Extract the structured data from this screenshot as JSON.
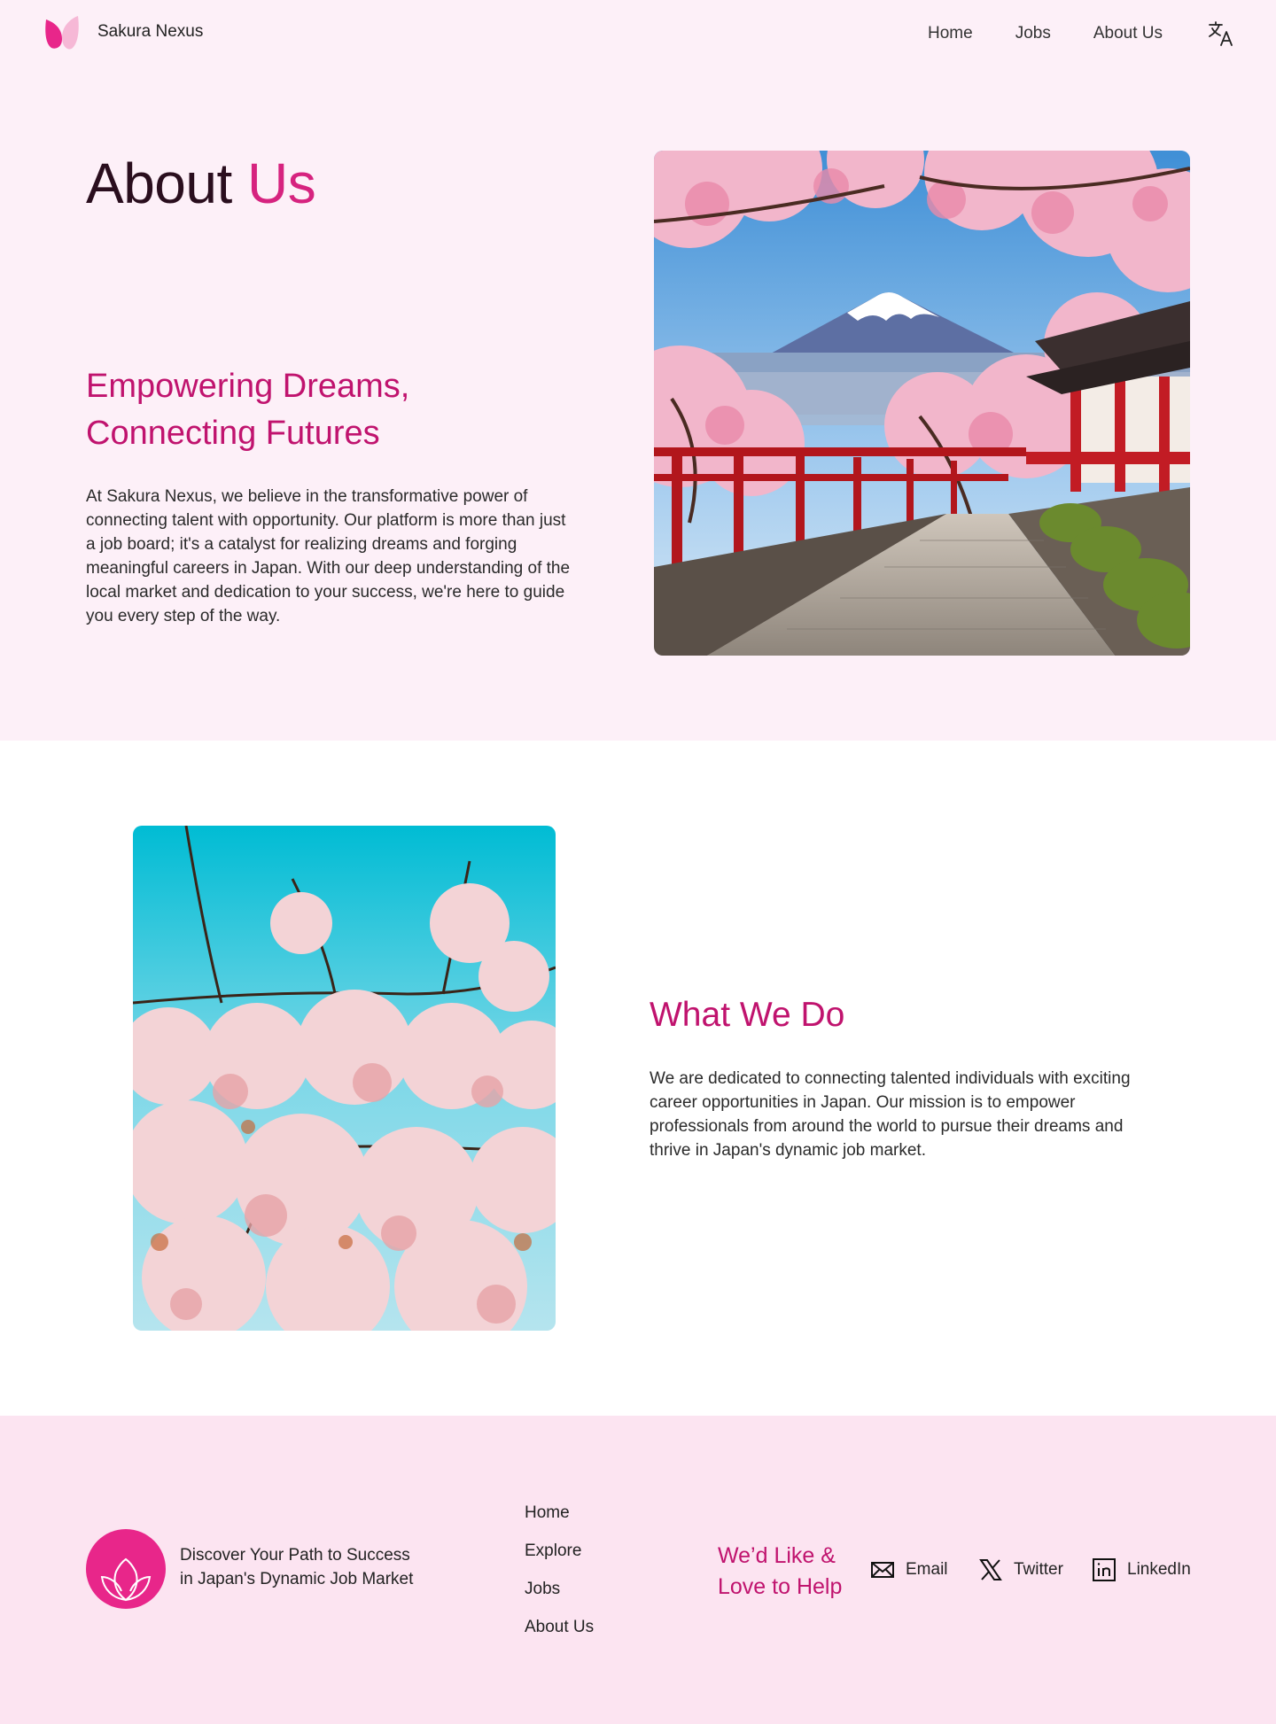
{
  "brand": {
    "name": "Sakura Nexus",
    "logo_icon": "sakura-petal-logo"
  },
  "nav": {
    "links": [
      {
        "label": "Home"
      },
      {
        "label": "Jobs"
      },
      {
        "label": "About Us"
      }
    ],
    "translate_icon": "translate-icon"
  },
  "hero": {
    "title_main": "About",
    "title_accent": "Us",
    "subtitle": "Empowering Dreams, Connecting Futures",
    "body": "At Sakura Nexus, we believe in the transformative power of connecting talent with opportunity. Our platform is more than just a job board; it's a catalyst for realizing dreams and forging meaningful careers in Japan. With our deep understanding of the local market and dedication to your success, we're here to guide you every step of the way."
  },
  "what_we_do": {
    "title": "What We Do",
    "body": "We are dedicated to connecting talented individuals with exciting career opportunities in Japan. Our mission is to empower professionals from around the world to pursue their dreams and thrive in Japan's dynamic job market."
  },
  "footer": {
    "tagline": "Discover Your Path to Success in Japan's Dynamic Job Market",
    "links": [
      {
        "label": "Home"
      },
      {
        "label": "Explore"
      },
      {
        "label": "Jobs"
      },
      {
        "label": "About Us"
      }
    ],
    "help_text": "We’d Like & Love to Help",
    "social": [
      {
        "label": "Email",
        "icon": "email-icon"
      },
      {
        "label": "Twitter",
        "icon": "x-twitter-icon"
      },
      {
        "label": "LinkedIn",
        "icon": "linkedin-icon"
      }
    ]
  },
  "colors": {
    "accent": "#d6237f",
    "accent_dark": "#c0136e",
    "hero_bg": "#fdf0f8",
    "footer_bg": "#fce4f1",
    "logo_pink": "#e8268a"
  }
}
